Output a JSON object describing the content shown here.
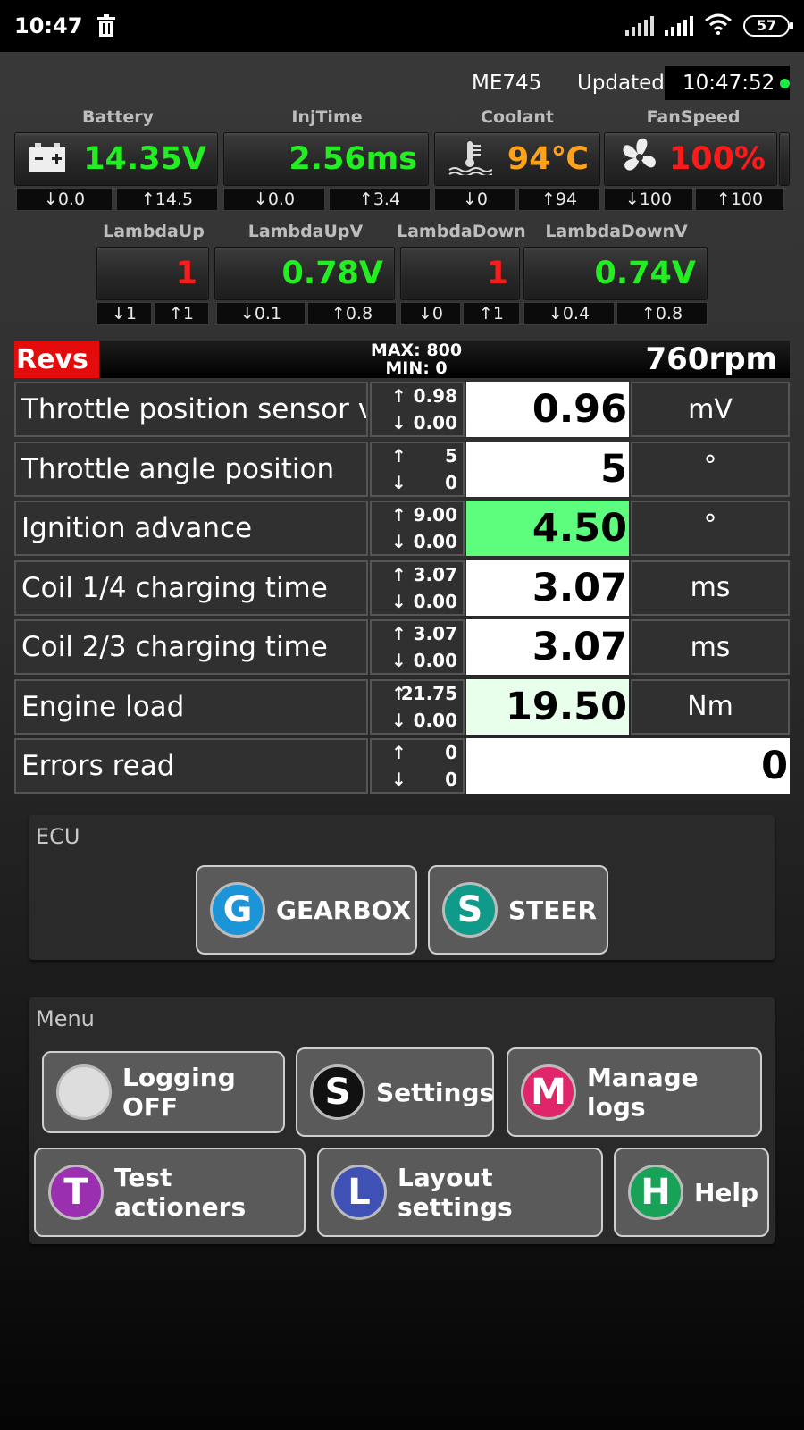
{
  "status_bar": {
    "time": "10:47",
    "battery": "57"
  },
  "header": {
    "car": "ME745",
    "updated_label": "Updated:",
    "updated_time": "10:47:52"
  },
  "gauges_top": [
    {
      "label": "Battery",
      "value": "14.35V",
      "color": "#22ee22",
      "icon": "car-battery-icon",
      "min": "0.0",
      "max": "14.5"
    },
    {
      "label": "InjTime",
      "value": "2.56ms",
      "color": "#22ee22",
      "icon": "",
      "min": "0.0",
      "max": "3.4"
    },
    {
      "label": "Coolant",
      "value": "94℃",
      "color": "#ffa21a",
      "icon": "coolant-temp-icon",
      "min": "0",
      "max": "94"
    },
    {
      "label": "FanSpeed",
      "value": "100%",
      "color": "#ff1a1a",
      "icon": "fan-icon",
      "min": "100",
      "max": "100"
    }
  ],
  "gauges_lambda": [
    {
      "label": "LambdaUp",
      "value": "1",
      "color": "#ff1a1a",
      "min": "1",
      "max": "1"
    },
    {
      "label": "LambdaUpV",
      "value": "0.78V",
      "color": "#22ee22",
      "min": "0.1",
      "max": "0.8"
    },
    {
      "label": "LambdaDown",
      "value": "1",
      "color": "#ff1a1a",
      "min": "0",
      "max": "1"
    },
    {
      "label": "LambdaDownV",
      "value": "0.74V",
      "color": "#22ee22",
      "min": "0.4",
      "max": "0.8"
    }
  ],
  "revs": {
    "label": "Revs",
    "max": "MAX: 800",
    "min": "MIN: 0",
    "value": "760rpm"
  },
  "rows": [
    {
      "name": "Throttle position sensor vol",
      "up": "0.98",
      "down": "0.00",
      "value": "0.96",
      "unit": "mV",
      "bg": "#ffffff"
    },
    {
      "name": "Throttle angle position",
      "up": "5",
      "down": "0",
      "value": "5",
      "unit": "°",
      "bg": "#ffffff"
    },
    {
      "name": "Ignition advance",
      "up": "9.00",
      "down": "0.00",
      "value": "4.50",
      "unit": "°",
      "bg": "#5dfd7d"
    },
    {
      "name": "Coil 1/4 charging time",
      "up": "3.07",
      "down": "0.00",
      "value": "3.07",
      "unit": "ms",
      "bg": "#ffffff"
    },
    {
      "name": "Coil 2/3 charging time",
      "up": "3.07",
      "down": "0.00",
      "value": "3.07",
      "unit": "ms",
      "bg": "#ffffff"
    },
    {
      "name": "Engine load",
      "up": "21.75",
      "down": "0.00",
      "value": "19.50",
      "unit": "Nm",
      "bg": "#e8ffeb"
    },
    {
      "name": "Errors read",
      "up": "0",
      "down": "0",
      "value": "0",
      "unit": "",
      "bg": "#ffffff"
    }
  ],
  "ecu": {
    "title": "ECU",
    "buttons": [
      {
        "letter": "G",
        "label": "GEARBOX",
        "color": "#1b94d8"
      },
      {
        "letter": "S",
        "label": "STEER",
        "color": "#0f9a8a"
      }
    ]
  },
  "menu": {
    "title": "Menu",
    "buttons": [
      {
        "letter": "",
        "label": "Logging OFF",
        "color": "#dddddd"
      },
      {
        "letter": "S",
        "label": "Settings",
        "color": "#111111"
      },
      {
        "letter": "M",
        "label": "Manage logs",
        "color": "#e0256b"
      },
      {
        "letter": "T",
        "label": "Test actioners",
        "color": "#9a2fb0"
      },
      {
        "letter": "L",
        "label": "Layout settings",
        "color": "#3f51b5"
      },
      {
        "letter": "H",
        "label": "Help",
        "color": "#17a257"
      }
    ]
  }
}
